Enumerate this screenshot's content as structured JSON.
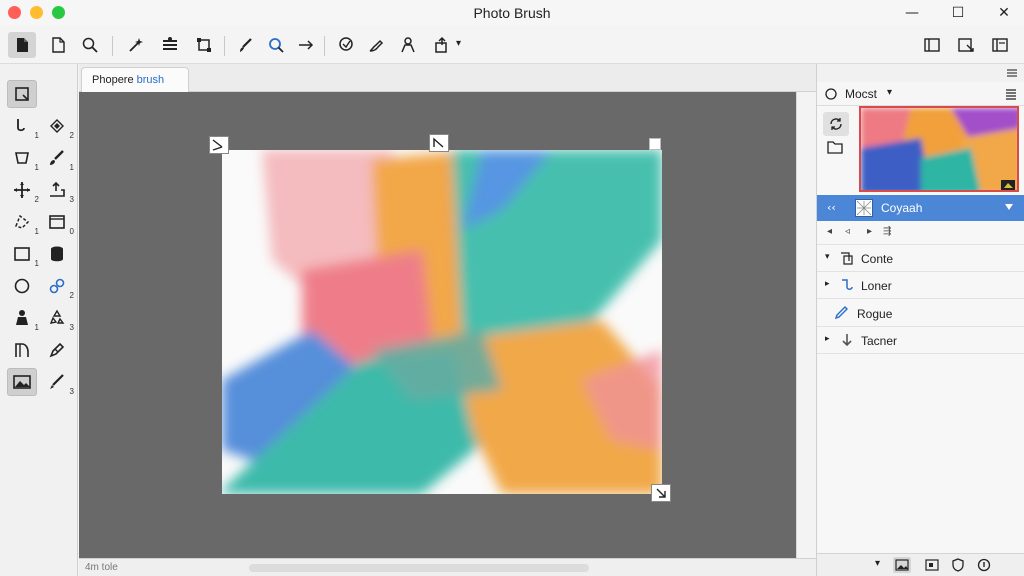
{
  "window": {
    "title": "Photo Brush",
    "traffic_colors": [
      "#ff5f57",
      "#febc2e",
      "#28c840"
    ],
    "minimize": "—",
    "maximize": "☐",
    "close": "✕"
  },
  "toolbar": {
    "icons": [
      "new-document-icon",
      "open-document-icon",
      "zoom-icon",
      "magic-wand-icon",
      "levels-icon",
      "transform-icon",
      "brush-icon",
      "search-brush-icon",
      "arrow-icon",
      "lasso-icon",
      "pen-icon",
      "person-icon",
      "export-icon",
      "panel-left-icon",
      "crop-icon",
      "panel-right-icon"
    ],
    "dropdown_caret": "▾"
  },
  "tools": {
    "labels": [
      "1",
      "2",
      "1",
      "1",
      "2",
      "3",
      "1",
      "0",
      "1",
      "2",
      "1",
      "3",
      "3"
    ]
  },
  "document": {
    "tab_label_prefix": "Phopere ",
    "tab_label_accent": "brush",
    "accent_color": "#2a6dc8"
  },
  "status": {
    "text": "4m tole"
  },
  "right_panel": {
    "header_label": "Mocst",
    "layer_active_label": "Coyaah",
    "layer_controls": [
      "◂",
      "◃",
      "▸",
      "⇶"
    ],
    "rows": [
      {
        "chevron": "▾",
        "label": "Conte"
      },
      {
        "chevron": "▸",
        "label": "Loner"
      },
      {
        "chevron": "",
        "label": "Rogue"
      },
      {
        "chevron": "▸",
        "label": "Tacner"
      }
    ],
    "active_color": "#4c86d6"
  }
}
